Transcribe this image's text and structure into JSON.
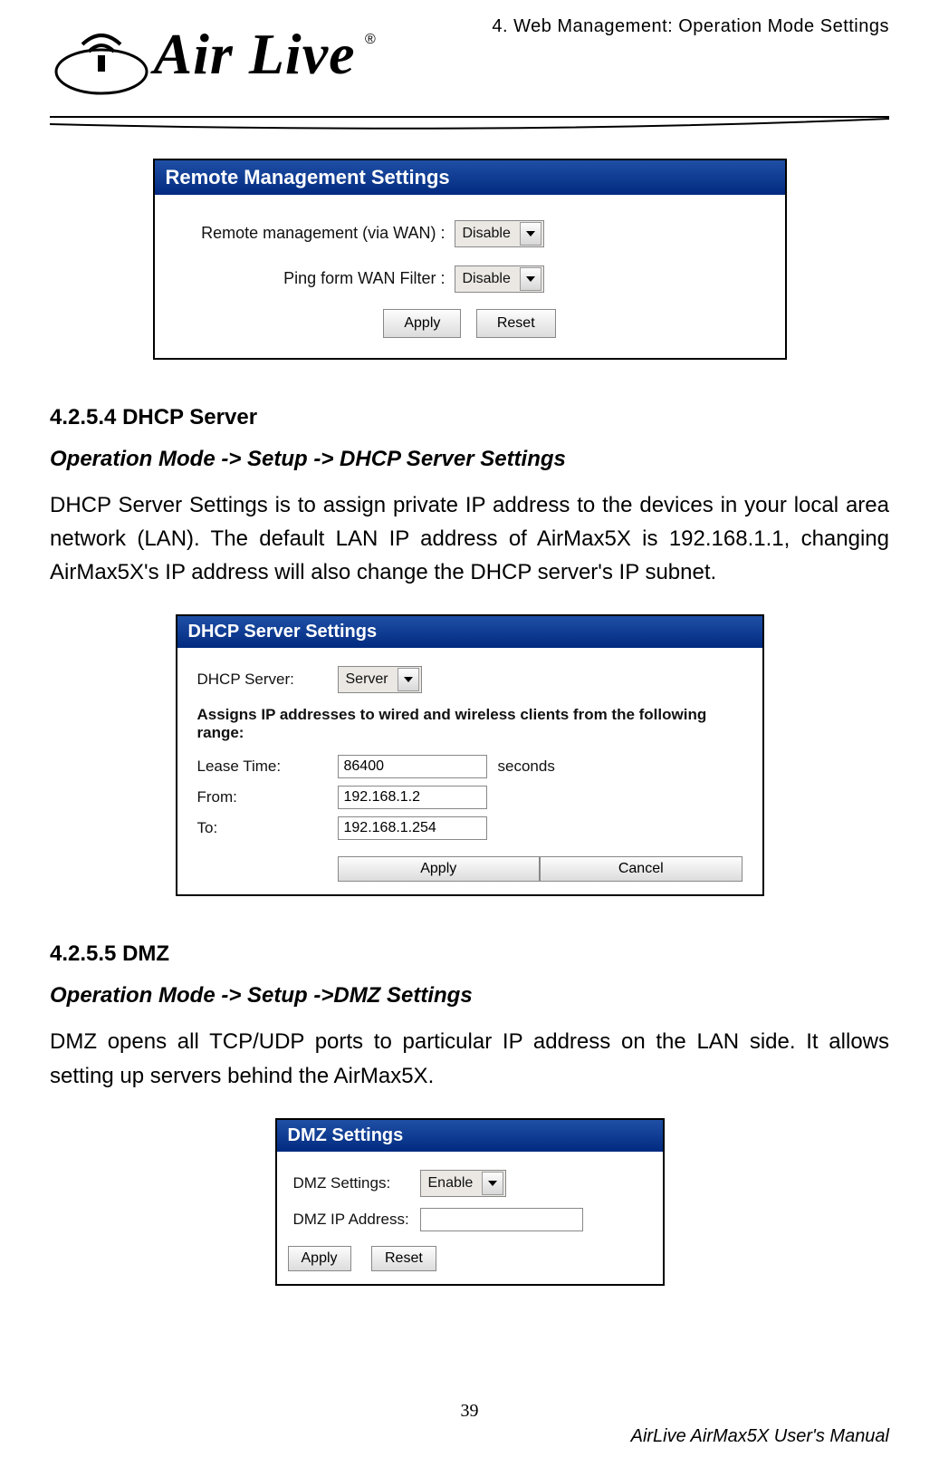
{
  "header": {
    "page_header": "4. Web Management: Operation Mode Settings",
    "logo_text": "Air Live",
    "reg_mark": "®"
  },
  "panels": {
    "remote": {
      "title": "Remote Management Settings",
      "rows": {
        "remote_mgmt": {
          "label": "Remote management (via WAN) :",
          "value": "Disable"
        },
        "ping_filter": {
          "label": "Ping form WAN Filter :",
          "value": "Disable"
        }
      },
      "buttons": {
        "apply": "Apply",
        "reset": "Reset"
      }
    },
    "dhcp": {
      "title": "DHCP Server Settings",
      "rows": {
        "server": {
          "label": "DHCP Server:",
          "value": "Server"
        },
        "note": "Assigns IP addresses to wired and wireless clients from the following range:",
        "lease": {
          "label": "Lease Time:",
          "value": "86400",
          "suffix": "seconds"
        },
        "from": {
          "label": "From:",
          "value": "192.168.1.2"
        },
        "to": {
          "label": "To:",
          "value": "192.168.1.254"
        }
      },
      "buttons": {
        "apply": "Apply",
        "cancel": "Cancel"
      }
    },
    "dmz": {
      "title": "DMZ Settings",
      "rows": {
        "setting": {
          "label": "DMZ Settings:",
          "value": "Enable"
        },
        "ip": {
          "label": "DMZ IP Address:",
          "value": ""
        }
      },
      "buttons": {
        "apply": "Apply",
        "reset": "Reset"
      }
    }
  },
  "sections": {
    "dhcp_head": "4.2.5.4    DHCP Server",
    "dhcp_sub": "Operation Mode -> Setup -> DHCP Server Settings",
    "dhcp_body": "DHCP Server Settings is to assign private IP address to the devices in your local area network (LAN). The default LAN IP address of AirMax5X is 192.168.1.1, changing AirMax5X's IP address will also change the DHCP server's IP subnet.",
    "dmz_head": "4.2.5.5    DMZ",
    "dmz_sub": "Operation Mode -> Setup ->DMZ Settings",
    "dmz_body": "DMZ opens all TCP/UDP ports to particular IP address on the LAN side. It allows setting up servers behind the AirMax5X."
  },
  "footer": {
    "page_number": "39",
    "manual_title": "AirLive AirMax5X User's Manual"
  }
}
